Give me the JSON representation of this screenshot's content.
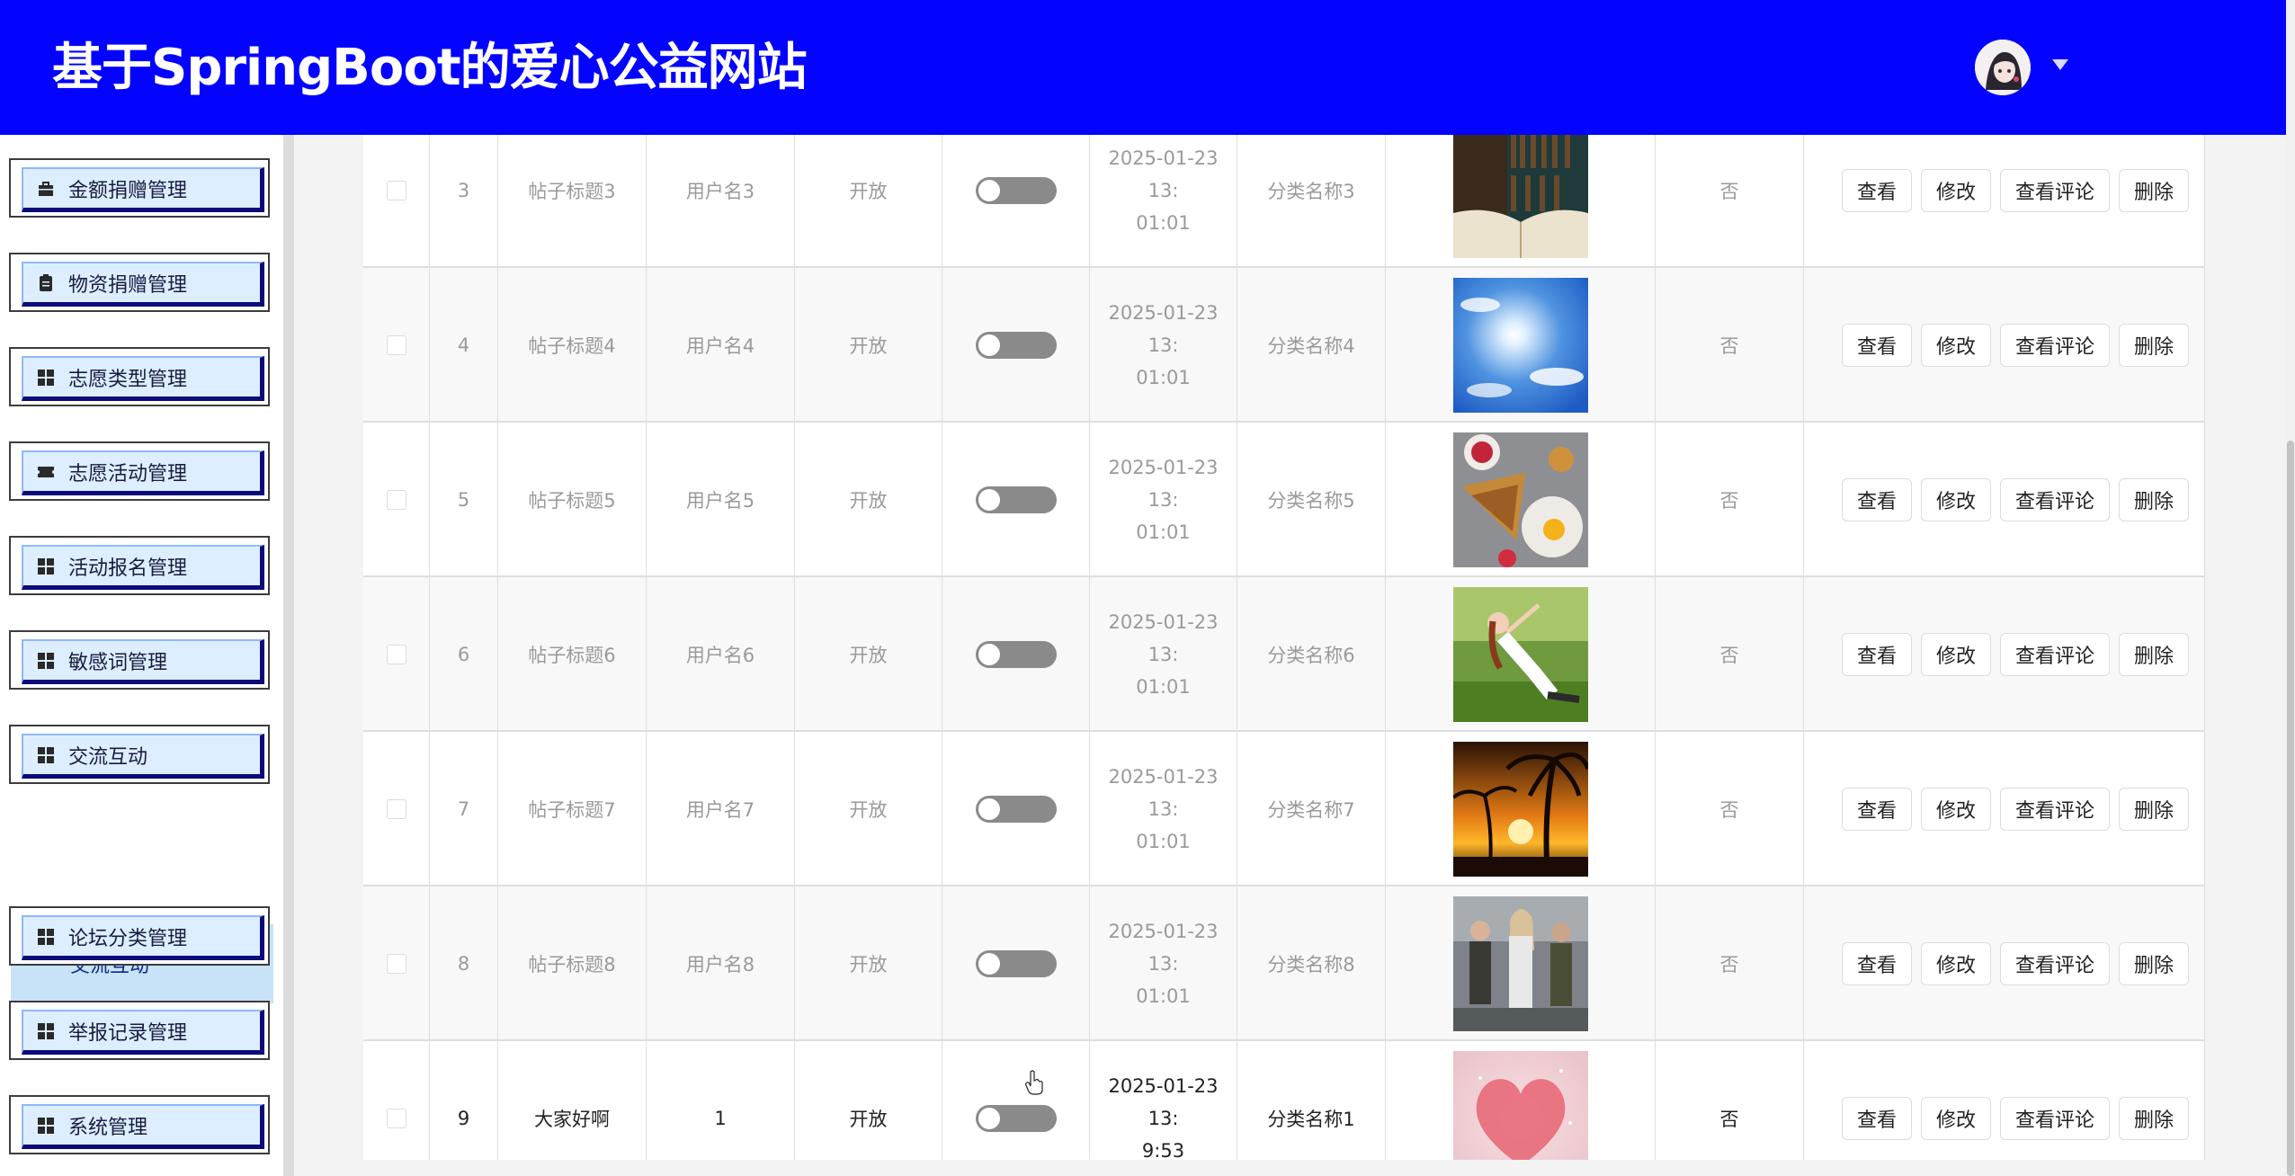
{
  "header": {
    "site_title": "基于SpringBoot的爱心公益网站"
  },
  "sidebar": {
    "items": [
      {
        "label": "金额捐赠管理",
        "icon": "briefcase-icon"
      },
      {
        "label": "物资捐赠管理",
        "icon": "clipboard-icon"
      },
      {
        "label": "志愿类型管理",
        "icon": "grid-icon"
      },
      {
        "label": "志愿活动管理",
        "icon": "ticket-icon"
      },
      {
        "label": "活动报名管理",
        "icon": "grid-icon"
      },
      {
        "label": "敏感词管理",
        "icon": "grid-icon"
      },
      {
        "label": "交流互动",
        "icon": "grid-icon"
      },
      {
        "label": "论坛分类管理",
        "icon": "grid-icon"
      },
      {
        "label": "举报记录管理",
        "icon": "grid-icon"
      },
      {
        "label": "系统管理",
        "icon": "grid-icon"
      }
    ],
    "submenu": {
      "label": "交流互动"
    }
  },
  "table": {
    "rows": [
      {
        "id": "3",
        "title": "帖子标题3",
        "user": "用户名3",
        "status": "开放",
        "time": "2025-01-23 13:\n01:01",
        "category": "分类名称3",
        "is_top": "否",
        "image": "library-book-image"
      },
      {
        "id": "4",
        "title": "帖子标题4",
        "user": "用户名4",
        "status": "开放",
        "time": "2025-01-23 13:\n01:01",
        "category": "分类名称4",
        "is_top": "否",
        "image": "sun-sky-image"
      },
      {
        "id": "5",
        "title": "帖子标题5",
        "user": "用户名5",
        "status": "开放",
        "time": "2025-01-23 13:\n01:01",
        "category": "分类名称5",
        "is_top": "否",
        "image": "breakfast-food-image"
      },
      {
        "id": "6",
        "title": "帖子标题6",
        "user": "用户名6",
        "status": "开放",
        "time": "2025-01-23 13:\n01:01",
        "category": "分类名称6",
        "is_top": "否",
        "image": "yoga-woman-image"
      },
      {
        "id": "7",
        "title": "帖子标题7",
        "user": "用户名7",
        "status": "开放",
        "time": "2025-01-23 13:\n01:01",
        "category": "分类名称7",
        "is_top": "否",
        "image": "palm-sunset-image"
      },
      {
        "id": "8",
        "title": "帖子标题8",
        "user": "用户名8",
        "status": "开放",
        "time": "2025-01-23 13:\n01:01",
        "category": "分类名称8",
        "is_top": "否",
        "image": "movie-characters-image"
      },
      {
        "id": "9",
        "title": "大家好啊",
        "user": "1",
        "status": "开放",
        "time": "2025-01-23 13:\n9:53",
        "category": "分类名称1",
        "is_top": "否",
        "image": "heart-image"
      }
    ],
    "actions": {
      "view": "查看",
      "edit": "修改",
      "view_comments": "查看评论",
      "delete": "删除"
    }
  },
  "colors": {
    "header_bg": "#0303ff",
    "menu_bg": "#dceeff",
    "submenu_bg": "#c8e2f8",
    "switch_off": "#8a8a8a"
  }
}
